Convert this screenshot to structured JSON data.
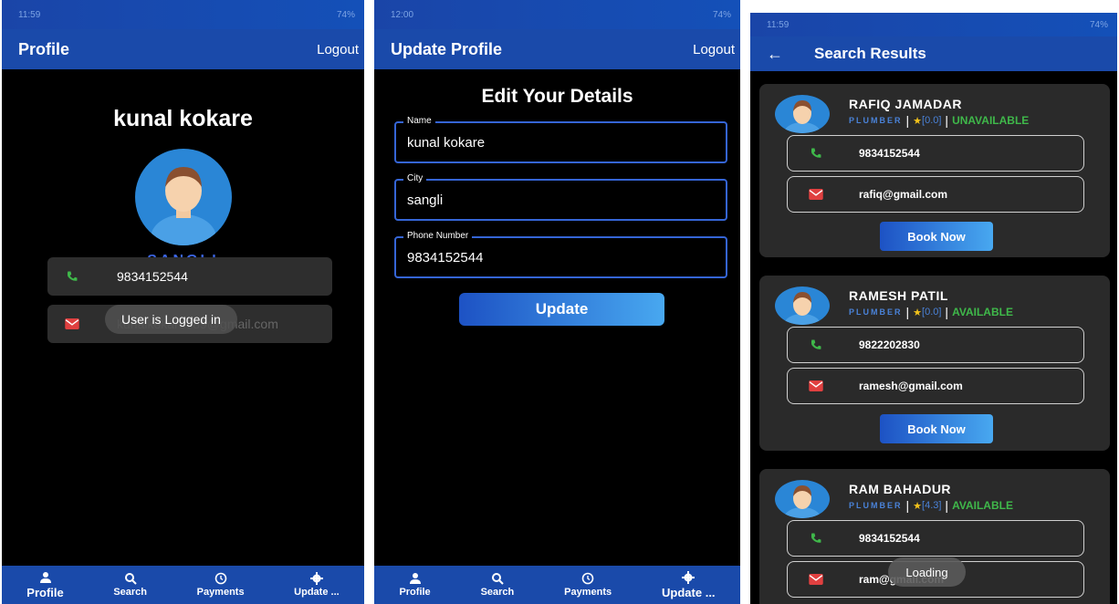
{
  "profile_screen": {
    "status_time": "11:59",
    "status_battery": "74%",
    "title": "Profile",
    "logout": "Logout",
    "name": "kunal kokare",
    "city": "SANGLI",
    "phone": "9834152544",
    "email": "kunalkokare789@gmail.com",
    "toast": "User is Logged in"
  },
  "update_screen": {
    "status_time": "12:00",
    "status_battery": "74%",
    "title": "Update Profile",
    "logout": "Logout",
    "heading": "Edit Your Details",
    "fields": [
      {
        "label": "Name",
        "value": "kunal kokare"
      },
      {
        "label": "City",
        "value": "sangli"
      },
      {
        "label": "Phone Number",
        "value": "9834152544"
      }
    ],
    "update_button": "Update"
  },
  "search_screen": {
    "status_time": "11:59",
    "status_battery": "74%",
    "title": "Search Results",
    "results": [
      {
        "name": "RAFIQ JAMADAR",
        "profession": "PLUMBER",
        "rating": "[0.0]",
        "status": "UNAVAILABLE",
        "phone": "9834152544",
        "email": "rafiq@gmail.com",
        "button": "Book Now"
      },
      {
        "name": "RAMESH PATIL",
        "profession": "PLUMBER",
        "rating": "[0.0]",
        "status": "AVAILABLE",
        "phone": "9822202830",
        "email": "ramesh@gmail.com",
        "button": "Book Now"
      },
      {
        "name": "RAM BAHADUR",
        "profession": "PLUMBER",
        "rating": "[4.3]",
        "status": "AVAILABLE",
        "phone": "9834152544",
        "email": "ram@gmail.com"
      }
    ],
    "loading": "Loading"
  },
  "nav": {
    "profile": "Profile",
    "search": "Search",
    "payments": "Payments",
    "update": "Update ..."
  },
  "colors": {
    "appbar": "#1a4aaa",
    "accent_blue": "#3b64e0",
    "available": "#3fb84a",
    "star": "#f2c21b",
    "phone_icon": "#3fb84a",
    "mail_icon": "#e04040"
  }
}
